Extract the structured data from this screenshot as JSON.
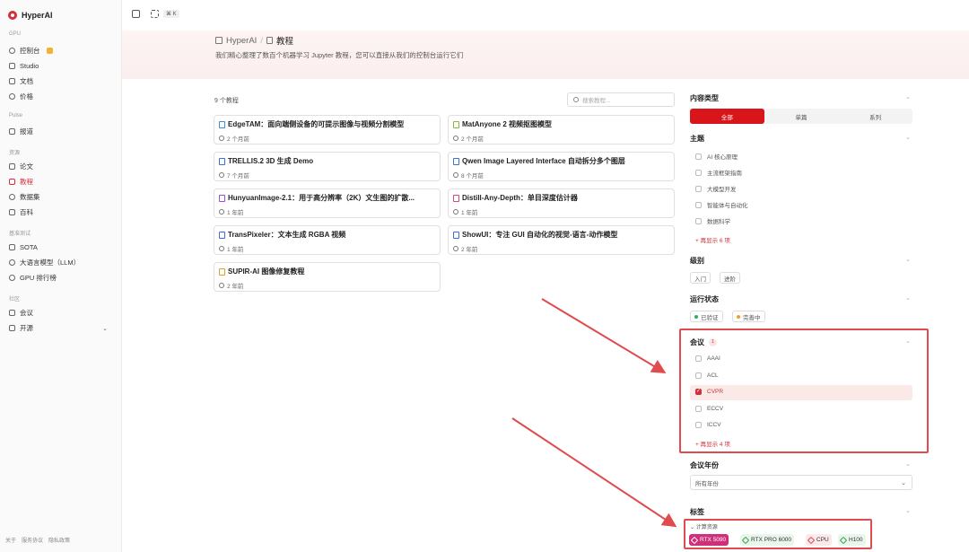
{
  "app": {
    "name": "HyperAI",
    "brand_color": "#d0303a"
  },
  "sidebar": {
    "sections": {
      "gpu": "GPU",
      "pulse": "Pulse",
      "resources": "资源",
      "benchmark": "基准测试",
      "community": "社区"
    },
    "items": [
      {
        "label": "控制台",
        "icon": "dashboard-icon"
      },
      {
        "label": "Studio",
        "icon": "wand-icon"
      },
      {
        "label": "文档",
        "icon": "doc-icon"
      },
      {
        "label": "价格",
        "icon": "price-icon"
      },
      {
        "label": "报道",
        "icon": "news-icon"
      },
      {
        "label": "论文",
        "icon": "paper-icon"
      },
      {
        "label": "教程",
        "icon": "book-icon",
        "active": true
      },
      {
        "label": "数据集",
        "icon": "database-icon"
      },
      {
        "label": "百科",
        "icon": "wiki-icon"
      },
      {
        "label": "SOTA",
        "icon": "trophy-icon"
      },
      {
        "label": "大语言模型（LLM）",
        "icon": "sparkle-icon"
      },
      {
        "label": "GPU 排行榜",
        "icon": "globe-icon"
      },
      {
        "label": "会议",
        "icon": "calendar-icon"
      },
      {
        "label": "开源",
        "icon": "code-icon"
      }
    ],
    "footer": [
      "关于",
      "服务协议",
      "隐私政策"
    ]
  },
  "topbar": {
    "shortcut": "⌘ K"
  },
  "hero": {
    "breadcrumb_home": "HyperAI",
    "breadcrumb_sep": "/",
    "breadcrumb_current": "教程",
    "description": "我们精心整理了数百个机器学习 Jupyter 教程，您可以直接从我们的控制台运行它们"
  },
  "main": {
    "count": "9 个教程",
    "search_placeholder": "搜索教程...",
    "cards": [
      {
        "title": "EdgeTAM：面向端侧设备的可提示图像与视频分割模型",
        "time": "2 个月前"
      },
      {
        "title": "MatAnyone 2 视频抠图模型",
        "time": "2 个月前"
      },
      {
        "title": "TRELLIS.2 3D 生成 Demo",
        "time": "7 个月前"
      },
      {
        "title": "Qwen Image Layered Interface 自动拆分多个图层",
        "time": "8 个月前"
      },
      {
        "title": "HunyuanImage-2.1：用于高分辨率（2K）文生图的扩散...",
        "time": "1 年前"
      },
      {
        "title": "Distill-Any-Depth：单目深度估计器",
        "time": "1 年前"
      },
      {
        "title": "TransPixeler：文本生成 RGBA 视频",
        "time": "1 年前"
      },
      {
        "title": "ShowUI：专注 GUI 自动化的视觉-语言-动作模型",
        "time": "2 年前"
      },
      {
        "title": "SUPIR-AI 图像修复教程",
        "time": "2 年前"
      }
    ]
  },
  "filters": {
    "content_type": {
      "title": "内容类型",
      "options": [
        "全部",
        "单篇",
        "系列"
      ],
      "selected": "全部"
    },
    "topic": {
      "title": "主题",
      "options": [
        "AI 核心原理",
        "主流框架指南",
        "大模型开发",
        "智能体与自动化",
        "数据科学"
      ],
      "more": "+ 再显示 6 项"
    },
    "level": {
      "title": "级别",
      "options": [
        "入门",
        "进阶"
      ]
    },
    "status": {
      "title": "运行状态",
      "options": [
        {
          "label": "已验证",
          "color": "#2fae55"
        },
        {
          "label": "完善中",
          "color": "#f0a020"
        }
      ]
    },
    "conference": {
      "title": "会议",
      "count": "1",
      "options": [
        "AAAI",
        "ACL",
        "CVPR",
        "ECCV",
        "ICCV"
      ],
      "checked": "CVPR",
      "more": "+ 再显示 4 项"
    },
    "conf_year": {
      "title": "会议年份",
      "value": "所有年份"
    },
    "tags": {
      "title": "标签",
      "group": "计算资源",
      "items": [
        "RTX 5090",
        "RTX PRO 6000",
        "CPU",
        "H100"
      ],
      "selected": "RTX 5090"
    }
  }
}
